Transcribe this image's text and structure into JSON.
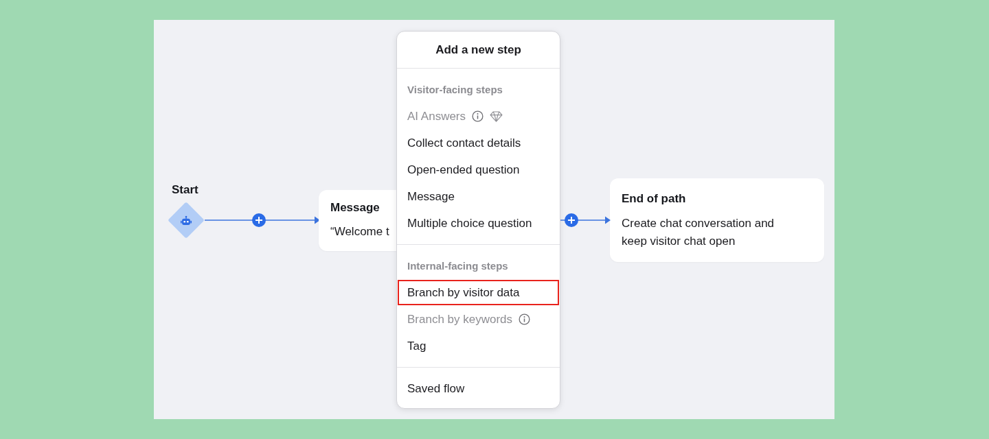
{
  "canvas": {
    "start": {
      "label": "Start"
    },
    "nodes": [
      {
        "kind": "message",
        "title": "Message",
        "text": "“Welcome t"
      },
      {
        "kind": "end",
        "title": "End of path",
        "text": "Create chat conversation and keep visitor chat open"
      }
    ]
  },
  "menu": {
    "title": "Add a new step",
    "sections": [
      {
        "label": "Visitor-facing steps",
        "items": [
          {
            "label": "AI Answers",
            "disabled": true,
            "info": true,
            "premium": true,
            "highlighted": false
          },
          {
            "label": "Collect contact details",
            "disabled": false,
            "info": false,
            "premium": false,
            "highlighted": false
          },
          {
            "label": "Open-ended question",
            "disabled": false,
            "info": false,
            "premium": false,
            "highlighted": false
          },
          {
            "label": "Message",
            "disabled": false,
            "info": false,
            "premium": false,
            "highlighted": false
          },
          {
            "label": "Multiple choice question",
            "disabled": false,
            "info": false,
            "premium": false,
            "highlighted": false
          }
        ]
      },
      {
        "label": "Internal-facing steps",
        "items": [
          {
            "label": "Branch by visitor data",
            "disabled": false,
            "info": false,
            "premium": false,
            "highlighted": true
          },
          {
            "label": "Branch by keywords",
            "disabled": true,
            "info": true,
            "premium": false,
            "highlighted": false
          },
          {
            "label": "Tag",
            "disabled": false,
            "info": false,
            "premium": false,
            "highlighted": false
          }
        ]
      },
      {
        "items": [
          {
            "label": "Saved flow",
            "disabled": false,
            "info": false,
            "premium": false,
            "highlighted": false
          }
        ]
      }
    ]
  }
}
